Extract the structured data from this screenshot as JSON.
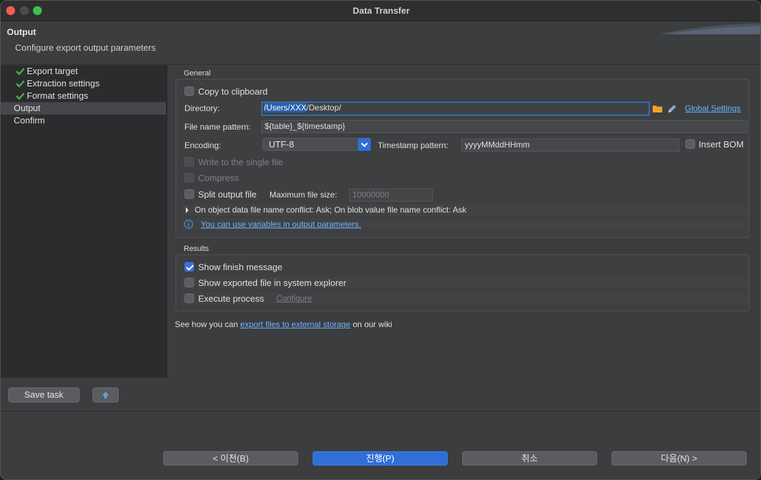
{
  "window": {
    "title": "Data Transfer"
  },
  "header": {
    "title": "Output",
    "subtitle": "Configure export output parameters"
  },
  "sidebar": {
    "items": [
      {
        "label": "Export target"
      },
      {
        "label": "Extraction settings"
      },
      {
        "label": "Format settings"
      },
      {
        "label": "Output"
      },
      {
        "label": "Confirm"
      }
    ],
    "save_task": "Save task"
  },
  "general": {
    "title": "General",
    "copy_to_clipboard": "Copy to clipboard",
    "directory_label": "Directory:",
    "directory_selected": "/Users/XXX",
    "directory_rest": "/Desktop/",
    "global_settings": "Global Settings",
    "file_name_label": "File name pattern:",
    "file_name_value": "${table}_${timestamp}",
    "encoding_label": "Encoding:",
    "encoding_value": "UTF-8",
    "timestamp_label": "Timestamp pattern:",
    "timestamp_value": "yyyyMMddHHmm",
    "insert_bom": "Insert BOM",
    "write_single": "Write to the single file",
    "compress": "Compress",
    "split_output": "Split output file",
    "max_size_label": "Maximum file size:",
    "max_size_value": "10000000",
    "conflict_text": "On object data file name conflict: Ask; On blob value file name conflict: Ask",
    "variables_link": "You can use variables in output parameters."
  },
  "results": {
    "title": "Results",
    "show_finish": "Show finish message",
    "show_exported": "Show exported file in system explorer",
    "execute_process": "Execute process",
    "configure": "Configure"
  },
  "wiki": {
    "prefix": "See how you can ",
    "link": "export files to external storage",
    "suffix": " on our wiki"
  },
  "footer": {
    "back": "< 이전(B)",
    "proceed": "진행(P)",
    "cancel": "취소",
    "next": "다음(N) >"
  },
  "colors": {
    "accent": "#2f6fd6",
    "link": "#6fb5ff",
    "check": "#4caf50",
    "folder": "#f0a030"
  },
  "icons": [
    "check-icon",
    "folder-icon",
    "pencil-icon",
    "info-icon",
    "chevron-right-icon",
    "chevron-down-icon",
    "upload-icon"
  ]
}
